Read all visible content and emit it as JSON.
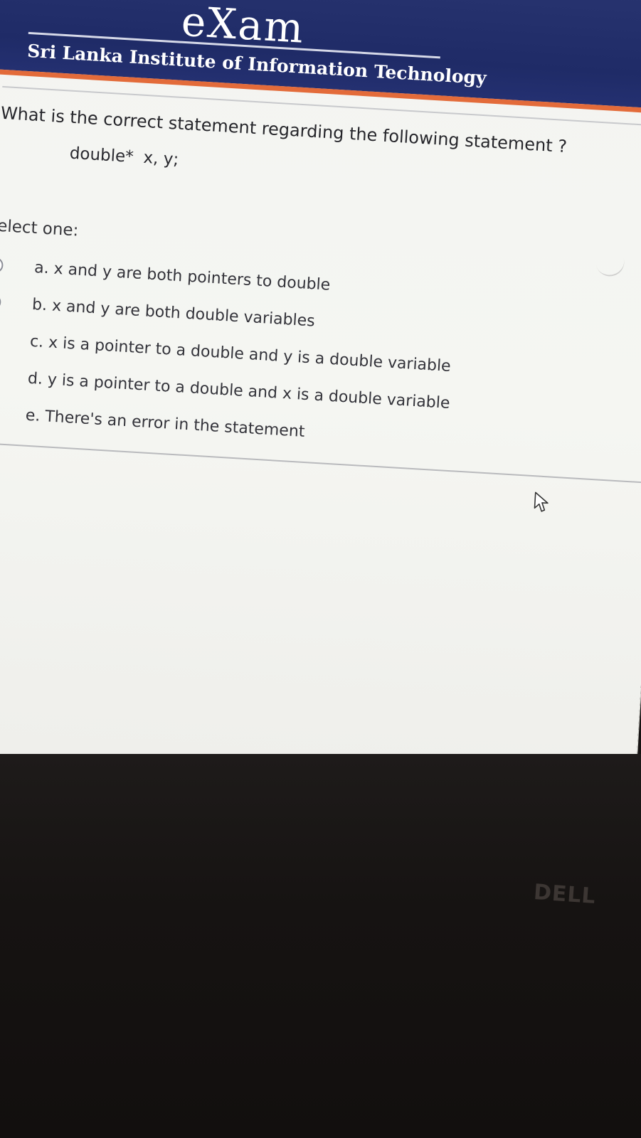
{
  "header": {
    "logo_text": "eXam",
    "institute_name": "Sri Lanka Institute of Information Technology"
  },
  "question": {
    "prompt": "What is the correct statement regarding the following statement ?",
    "code_type": "double*",
    "code_vars": "x, y;",
    "select_label": "Select one:",
    "options": [
      {
        "label": "a. x and y are both pointers to double",
        "selected": false
      },
      {
        "label": "b. x and y are both double variables",
        "selected": false
      },
      {
        "label": "c. x is a pointer to a double and y is a double variable",
        "selected": false
      },
      {
        "label": "d. y is a pointer to a double and x is a double variable",
        "selected": false
      },
      {
        "label": "e. There's an error in the statement",
        "selected": false
      }
    ]
  },
  "monitor": {
    "brand": "DELL"
  },
  "colors": {
    "header_bg": "#27336f",
    "header_accent": "#e36b3a",
    "page_bg": "#f3f4f1",
    "text": "#26262b"
  },
  "icons": [
    "radio-button-icon",
    "mouse-cursor-icon"
  ]
}
